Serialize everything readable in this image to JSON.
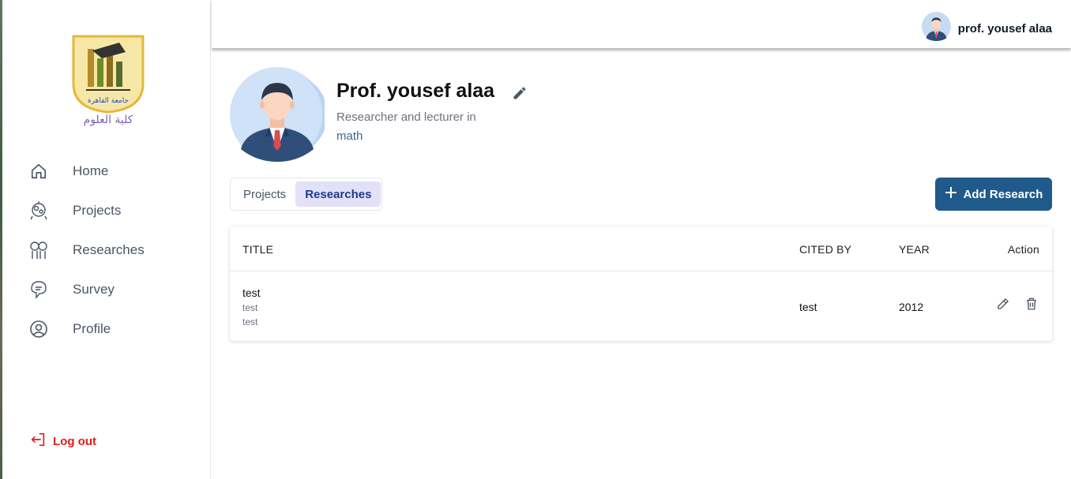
{
  "brand": {
    "logo_text": "كلية العلوم",
    "logo_arc_text": "جامعة القاهرة"
  },
  "sidebar": {
    "items": [
      {
        "label": "Home",
        "icon": "home-icon"
      },
      {
        "label": "Projects",
        "icon": "projects-icon"
      },
      {
        "label": "Researches",
        "icon": "researches-icon"
      },
      {
        "label": "Survey",
        "icon": "survey-icon"
      },
      {
        "label": "Profile",
        "icon": "profile-icon"
      }
    ],
    "logout_label": "Log out"
  },
  "topbar": {
    "user_name": "prof. yousef alaa"
  },
  "profile": {
    "name": "Prof. yousef alaa",
    "role": "Researcher and lecturer in",
    "field": "math"
  },
  "tabs": [
    {
      "label": "Projects",
      "active": false
    },
    {
      "label": "Researches",
      "active": true
    }
  ],
  "add_button_label": "Add Research",
  "table": {
    "headers": {
      "title": "TITLE",
      "cited_by": "CITED BY",
      "year": "YEAR",
      "action": "Action"
    },
    "rows": [
      {
        "title": "test",
        "sub1": "test",
        "sub2": "test",
        "cited_by": "test",
        "year": "2012"
      }
    ]
  },
  "colors": {
    "primary": "#1f5a8b",
    "danger": "#e11d1d",
    "tab_active_bg": "#e2e1f8",
    "field_text": "#356a95"
  }
}
